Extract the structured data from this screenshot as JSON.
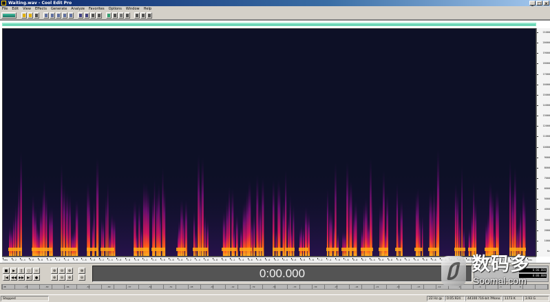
{
  "window": {
    "title": "Waiting.wav - Cool Edit Pro",
    "controls": [
      "_",
      "□",
      "×"
    ]
  },
  "menu": [
    "File",
    "Edit",
    "View",
    "Effects",
    "Generate",
    "Analyze",
    "Favorites",
    "Options",
    "Window",
    "Help"
  ],
  "toolbar": {
    "icons": [
      "waveform-view-icon",
      "open-icon",
      "save-icon",
      "close-file-icon",
      "cut-icon",
      "copy-icon",
      "paste-icon",
      "mix-paste-icon",
      "trim-icon",
      "undo-icon",
      "redo-icon",
      "select-all-icon",
      "repeat-icon",
      "spectral-view-icon",
      "zoom-icon",
      "cd-icon",
      "multitrack-icon",
      "settings-icon",
      "help-icon",
      "properties-icon"
    ]
  },
  "colors": {
    "spectrogram_background": "#0d1026",
    "spectrogram_low": "#3a0a5a",
    "spectrogram_mid": "#b0106a",
    "spectrogram_high": "#ff9a10",
    "overview_bar": "#3cc09c"
  },
  "spectrogram": {
    "overview_fill": 1.0,
    "frequency_axis": [
      "21000",
      "20000",
      "19000",
      "18000",
      "17000",
      "16000",
      "15000",
      "14000",
      "13000",
      "12000",
      "11000",
      "10000",
      "9000",
      "8000",
      "7000",
      "6000",
      "5000",
      "4000",
      "3000",
      "2000",
      "1000",
      "Hz"
    ],
    "time_axis": [
      "hms",
      "0.2",
      "0.4",
      "0.6",
      "0.8",
      "1.0",
      "1.2",
      "1.4",
      "1.6",
      "1.8",
      "2.0",
      "2.2",
      "2.4",
      "2.6",
      "2.8",
      "3.0",
      "3.2",
      "3.4",
      "3.6",
      "3.8",
      "4.0",
      "4.2",
      "4.4",
      "4.6",
      "4.8",
      "5.0",
      "5.2",
      "5.4",
      "5.6",
      "5.8",
      "6.0",
      "6.2",
      "6.4",
      "6.6",
      "6.8",
      "7.0",
      "7.2",
      "7.4",
      "7.6",
      "7.8",
      "8.0",
      "8.2",
      "8.4",
      "8.6",
      "8.8",
      "9.0",
      "9.2",
      "9.4",
      "9.6",
      "9.8",
      "10.0",
      "10.2",
      "10.4",
      "10.6",
      "10.8",
      "11.0",
      "11.2",
      "11.4",
      "11.6",
      "11.8",
      "hms"
    ]
  },
  "transport": {
    "current_time": "0:00.000",
    "buttons_top": [
      "■",
      "▶",
      "||",
      "○",
      "∞"
    ],
    "buttons_bottom": [
      "|◀",
      "◀◀",
      "▶▶",
      "▶|",
      "●"
    ],
    "zoom_buttons": [
      "⊕",
      "⊖",
      "⊕",
      "⊕",
      "⊖",
      "⊕"
    ]
  },
  "selection": {
    "begin": "0:00.000",
    "end": "0:00.000"
  },
  "level_meter": {
    "labels": [
      "dB",
      "-72",
      "-69",
      "-66",
      "-63",
      "-60",
      "-57",
      "-54",
      "-51",
      "-48",
      "-45",
      "-42",
      "-39",
      "-36",
      "-33",
      "-30",
      "-27",
      "-24",
      "-21",
      "-18",
      "-15",
      "-12",
      "-9",
      "-6",
      "-3",
      "0"
    ]
  },
  "status": {
    "state": "Stopped",
    "zoom_info": "22 Hz @",
    "duration": "0:05.924",
    "format": "44100 ?16-bit ?Mono",
    "size": "1173 K",
    "free": "3.93 G"
  },
  "watermark": {
    "chinese": "数码多",
    "site": "Soomal.com"
  }
}
